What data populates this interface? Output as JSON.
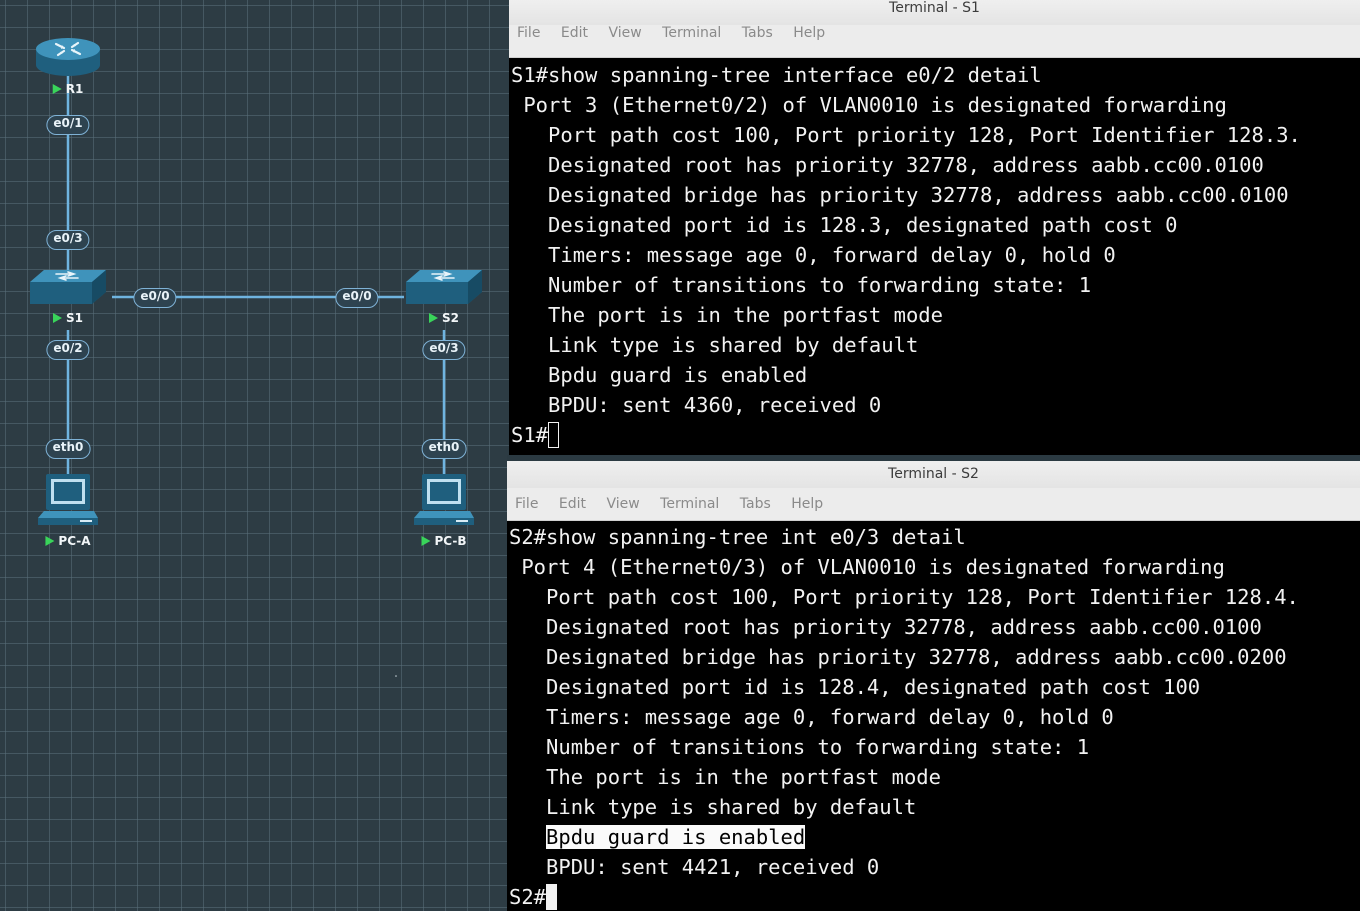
{
  "topology": {
    "nodes": {
      "r1": "R1",
      "s1": "S1",
      "s2": "S2",
      "pca": "PC-A",
      "pcb": "PC-B"
    },
    "interfaces": {
      "r1_e01": "e0/1",
      "s1_e03": "e0/3",
      "s1_e00": "e0/0",
      "s2_e00": "e0/0",
      "s1_e02": "e0/2",
      "s2_e03": "e0/3",
      "pca_eth0": "eth0",
      "pcb_eth0": "eth0"
    },
    "colors": {
      "link": "#6fb4e0",
      "running": "#39d45a",
      "grid": "#2d3c44"
    },
    "icons": {
      "router": "router-icon",
      "switch": "switch-icon",
      "pc": "pc-icon"
    }
  },
  "terminal_s1": {
    "title": "Terminal - S1",
    "menu": [
      "File",
      "Edit",
      "View",
      "Terminal",
      "Tabs",
      "Help"
    ],
    "lines": [
      "S1#show spanning-tree interface e0/2 detail",
      " Port 3 (Ethernet0/2) of VLAN0010 is designated forwarding",
      "   Port path cost 100, Port priority 128, Port Identifier 128.3.",
      "   Designated root has priority 32778, address aabb.cc00.0100",
      "   Designated bridge has priority 32778, address aabb.cc00.0100",
      "   Designated port id is 128.3, designated path cost 0",
      "   Timers: message age 0, forward delay 0, hold 0",
      "   Number of transitions to forwarding state: 1",
      "   The port is in the portfast mode",
      "   Link type is shared by default",
      "   Bpdu guard is enabled",
      "   BPDU: sent 4360, received 0"
    ],
    "prompt": "S1#"
  },
  "terminal_s2": {
    "title": "Terminal - S2",
    "menu": [
      "File",
      "Edit",
      "View",
      "Terminal",
      "Tabs",
      "Help"
    ],
    "lines": [
      "S2#show spanning-tree int e0/3 detail",
      " Port 4 (Ethernet0/3) of VLAN0010 is designated forwarding",
      "   Port path cost 100, Port priority 128, Port Identifier 128.4.",
      "   Designated root has priority 32778, address aabb.cc00.0100",
      "   Designated bridge has priority 32778, address aabb.cc00.0200",
      "   Designated port id is 128.4, designated path cost 100",
      "   Timers: message age 0, forward delay 0, hold 0",
      "   Number of transitions to forwarding state: 1",
      "   The port is in the portfast mode",
      "   Link type is shared by default"
    ],
    "selected_indent": "   ",
    "selected_text": "Bpdu guard is enabled",
    "after_lines": [
      "   BPDU: sent 4421, received 0"
    ],
    "prompt": "S2#"
  }
}
